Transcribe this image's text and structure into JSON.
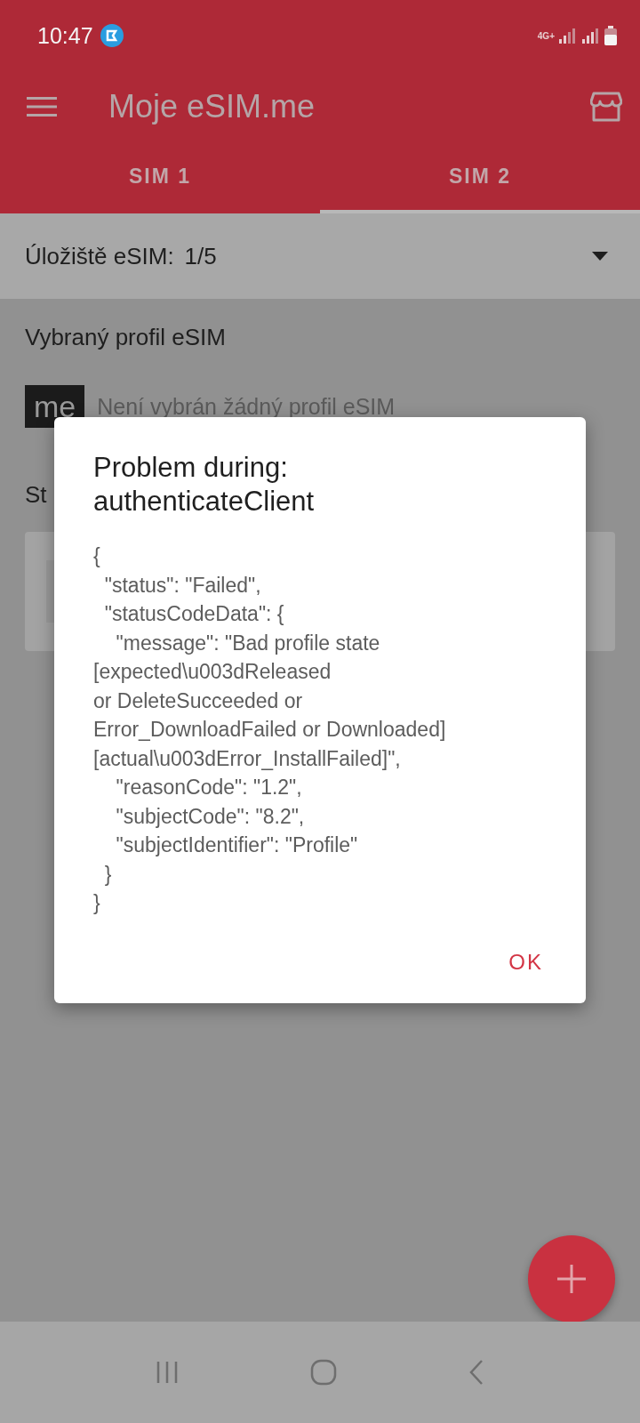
{
  "status_bar": {
    "time": "10:47",
    "network": "4G+"
  },
  "app_bar": {
    "title": "Moje eSIM.me"
  },
  "tabs": [
    {
      "label": "SIM 1",
      "selected": false
    },
    {
      "label": "SIM 2",
      "selected": true
    }
  ],
  "storage": {
    "label": "Úložiště eSIM:",
    "value": "1/5"
  },
  "section_title": "Vybraný profil eSIM",
  "profile": {
    "logo": "me",
    "text": "Není vybrán žádný profil eSIM"
  },
  "section_2_title": "St",
  "dialog": {
    "title": "Problem during:\nauthenticateClient",
    "body": "{\n  \"status\": \"Failed\",\n  \"statusCodeData\": {\n    \"message\": \"Bad profile state\n[expected\\u003dReleased\nor DeleteSucceeded or\nError_DownloadFailed or Downloaded]\n[actual\\u003dError_InstallFailed]\",\n    \"reasonCode\": \"1.2\",\n    \"subjectCode\": \"8.2\",\n    \"subjectIdentifier\": \"Profile\"\n  }\n}",
    "button": "OK"
  }
}
